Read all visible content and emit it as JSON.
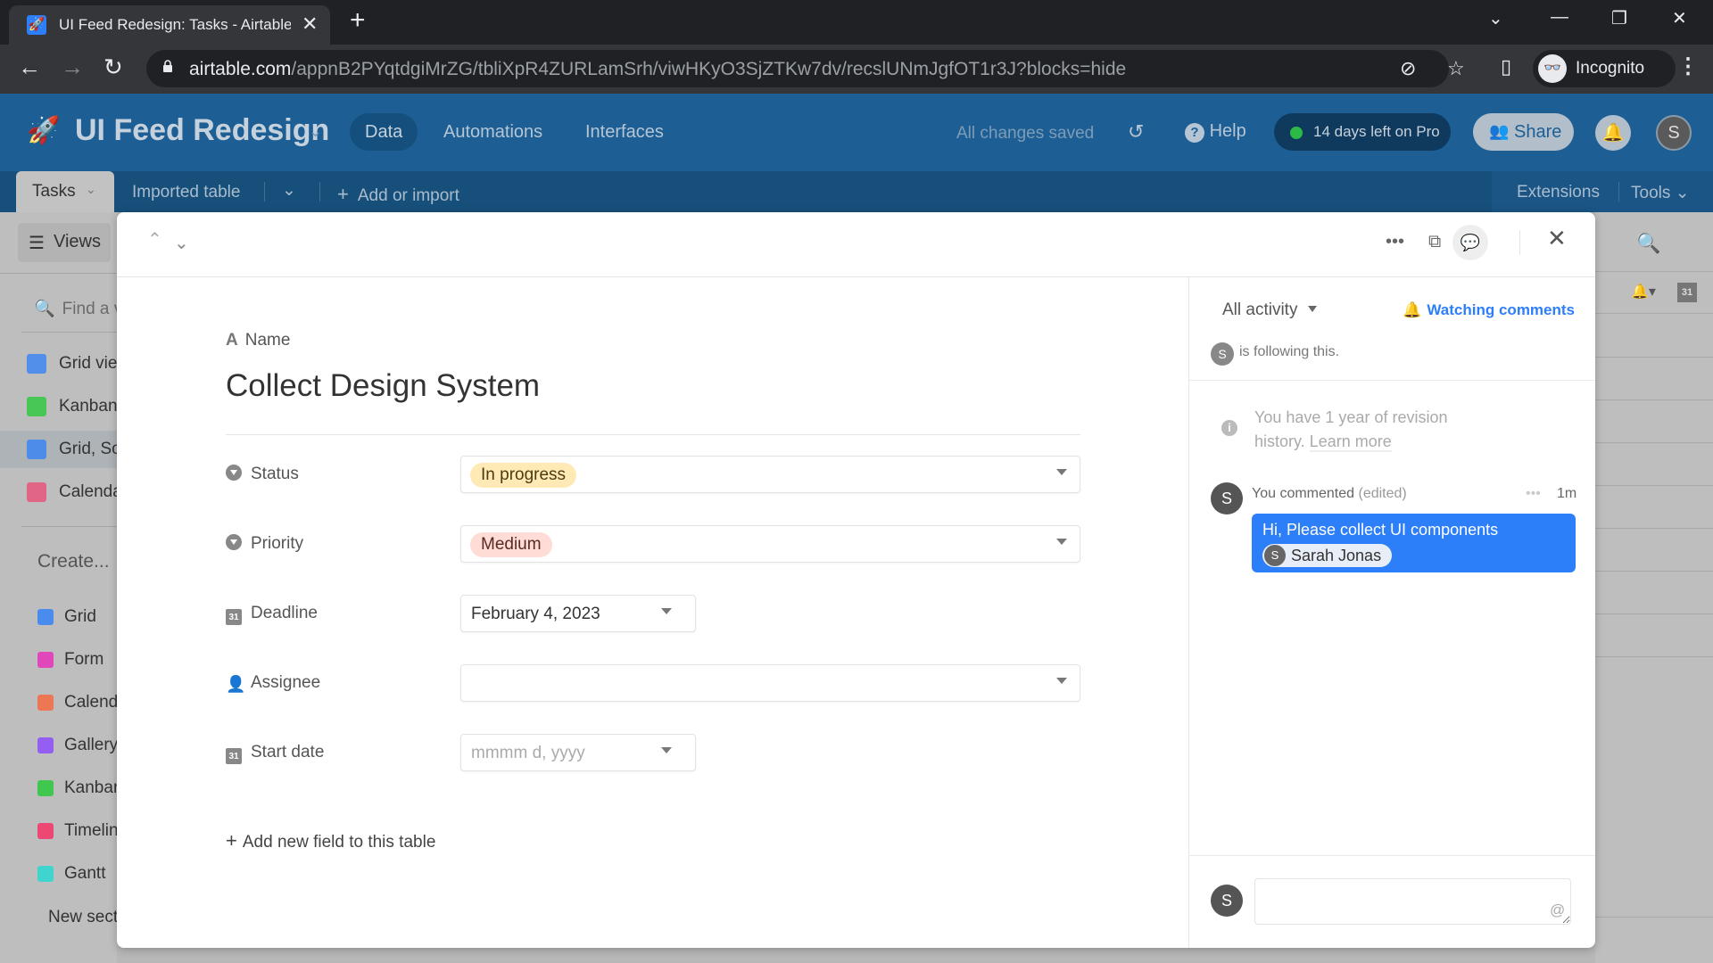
{
  "browser": {
    "tab_title": "UI Feed Redesign: Tasks - Airtable",
    "url_host": "airtable.com",
    "url_path": "/appnB2PYqtdgiMrZG/tbliXpR4ZURLamSrh/viwHKyO3SjZTKw7dv/recslUNmJgfOT1r3J?blocks=hide",
    "profile_label": "Incognito",
    "icons": {
      "back": "←",
      "forward": "→",
      "reload": "↻",
      "new_tab": "+",
      "tab_close": "✕",
      "star": "☆",
      "kebab": "⋮",
      "minimize": "—",
      "maximize": "❐",
      "close": "✕",
      "tab_search": "⌄"
    }
  },
  "header": {
    "base_title": "UI Feed Redesign",
    "nav": [
      "Data",
      "Automations",
      "Interfaces"
    ],
    "save_status": "All changes saved",
    "help_label": "Help",
    "trial_label": "14 days left on Pro",
    "share_label": "Share",
    "user_initial": "S"
  },
  "tables": {
    "active": "Tasks",
    "others": [
      "Imported table"
    ],
    "add_label": "Add or import",
    "extensions_label": "Extensions",
    "tools_label": "Tools"
  },
  "sidebar": {
    "views_label": "Views",
    "search_placeholder": "Find a view",
    "views": [
      {
        "label": "Grid view",
        "type": "grid",
        "color": "#2d7ff9"
      },
      {
        "label": "Kanban",
        "type": "kanban",
        "color": "#20c933"
      },
      {
        "label": "Grid, Sorted",
        "type": "grid",
        "color": "#2d7ff9",
        "selected": true
      },
      {
        "label": "Calendar",
        "type": "calendar",
        "color": "#f82b60"
      }
    ],
    "create_label": "Create...",
    "create_items": [
      {
        "label": "Grid",
        "color": "#2d7ff9"
      },
      {
        "label": "Form",
        "color": "#e929ba"
      },
      {
        "label": "Calendar",
        "color": "#f7653b"
      },
      {
        "label": "Gallery",
        "color": "#8b46ff"
      },
      {
        "label": "Kanban",
        "color": "#20c933"
      },
      {
        "label": "Timeline",
        "color": "#f82b60"
      },
      {
        "label": "Gantt",
        "color": "#20d9d2"
      }
    ],
    "new_section_label": "New section"
  },
  "record": {
    "name_field_label": "Name",
    "title": "Collect Design System",
    "fields": [
      {
        "label": "Status",
        "type": "select",
        "value": "In progress",
        "chip_color": "#ffeab6"
      },
      {
        "label": "Priority",
        "type": "select",
        "value": "Medium",
        "chip_color": "#ffdce5"
      },
      {
        "label": "Deadline",
        "type": "date",
        "value": "February 4, 2023"
      },
      {
        "label": "Assignee",
        "type": "user",
        "value": ""
      },
      {
        "label": "Start date",
        "type": "date",
        "placeholder": "mmmm d, yyyy"
      }
    ],
    "add_field_label": "Add new field to this table"
  },
  "activity": {
    "filter_label": "All activity",
    "watching_label": "Watching comments",
    "following_text": "is following this.",
    "revision_text": "You have 1 year of revision history.",
    "learn_more": "Learn more",
    "comments": [
      {
        "author_initial": "S",
        "meta": "You commented",
        "edited": "(edited)",
        "time": "1m",
        "text": "Hi, Please collect UI components",
        "mention": "Sarah Jonas",
        "mention_initial": "S"
      }
    ],
    "comment_input_placeholder": "",
    "mention_icon": "@",
    "user_initial": "S"
  }
}
